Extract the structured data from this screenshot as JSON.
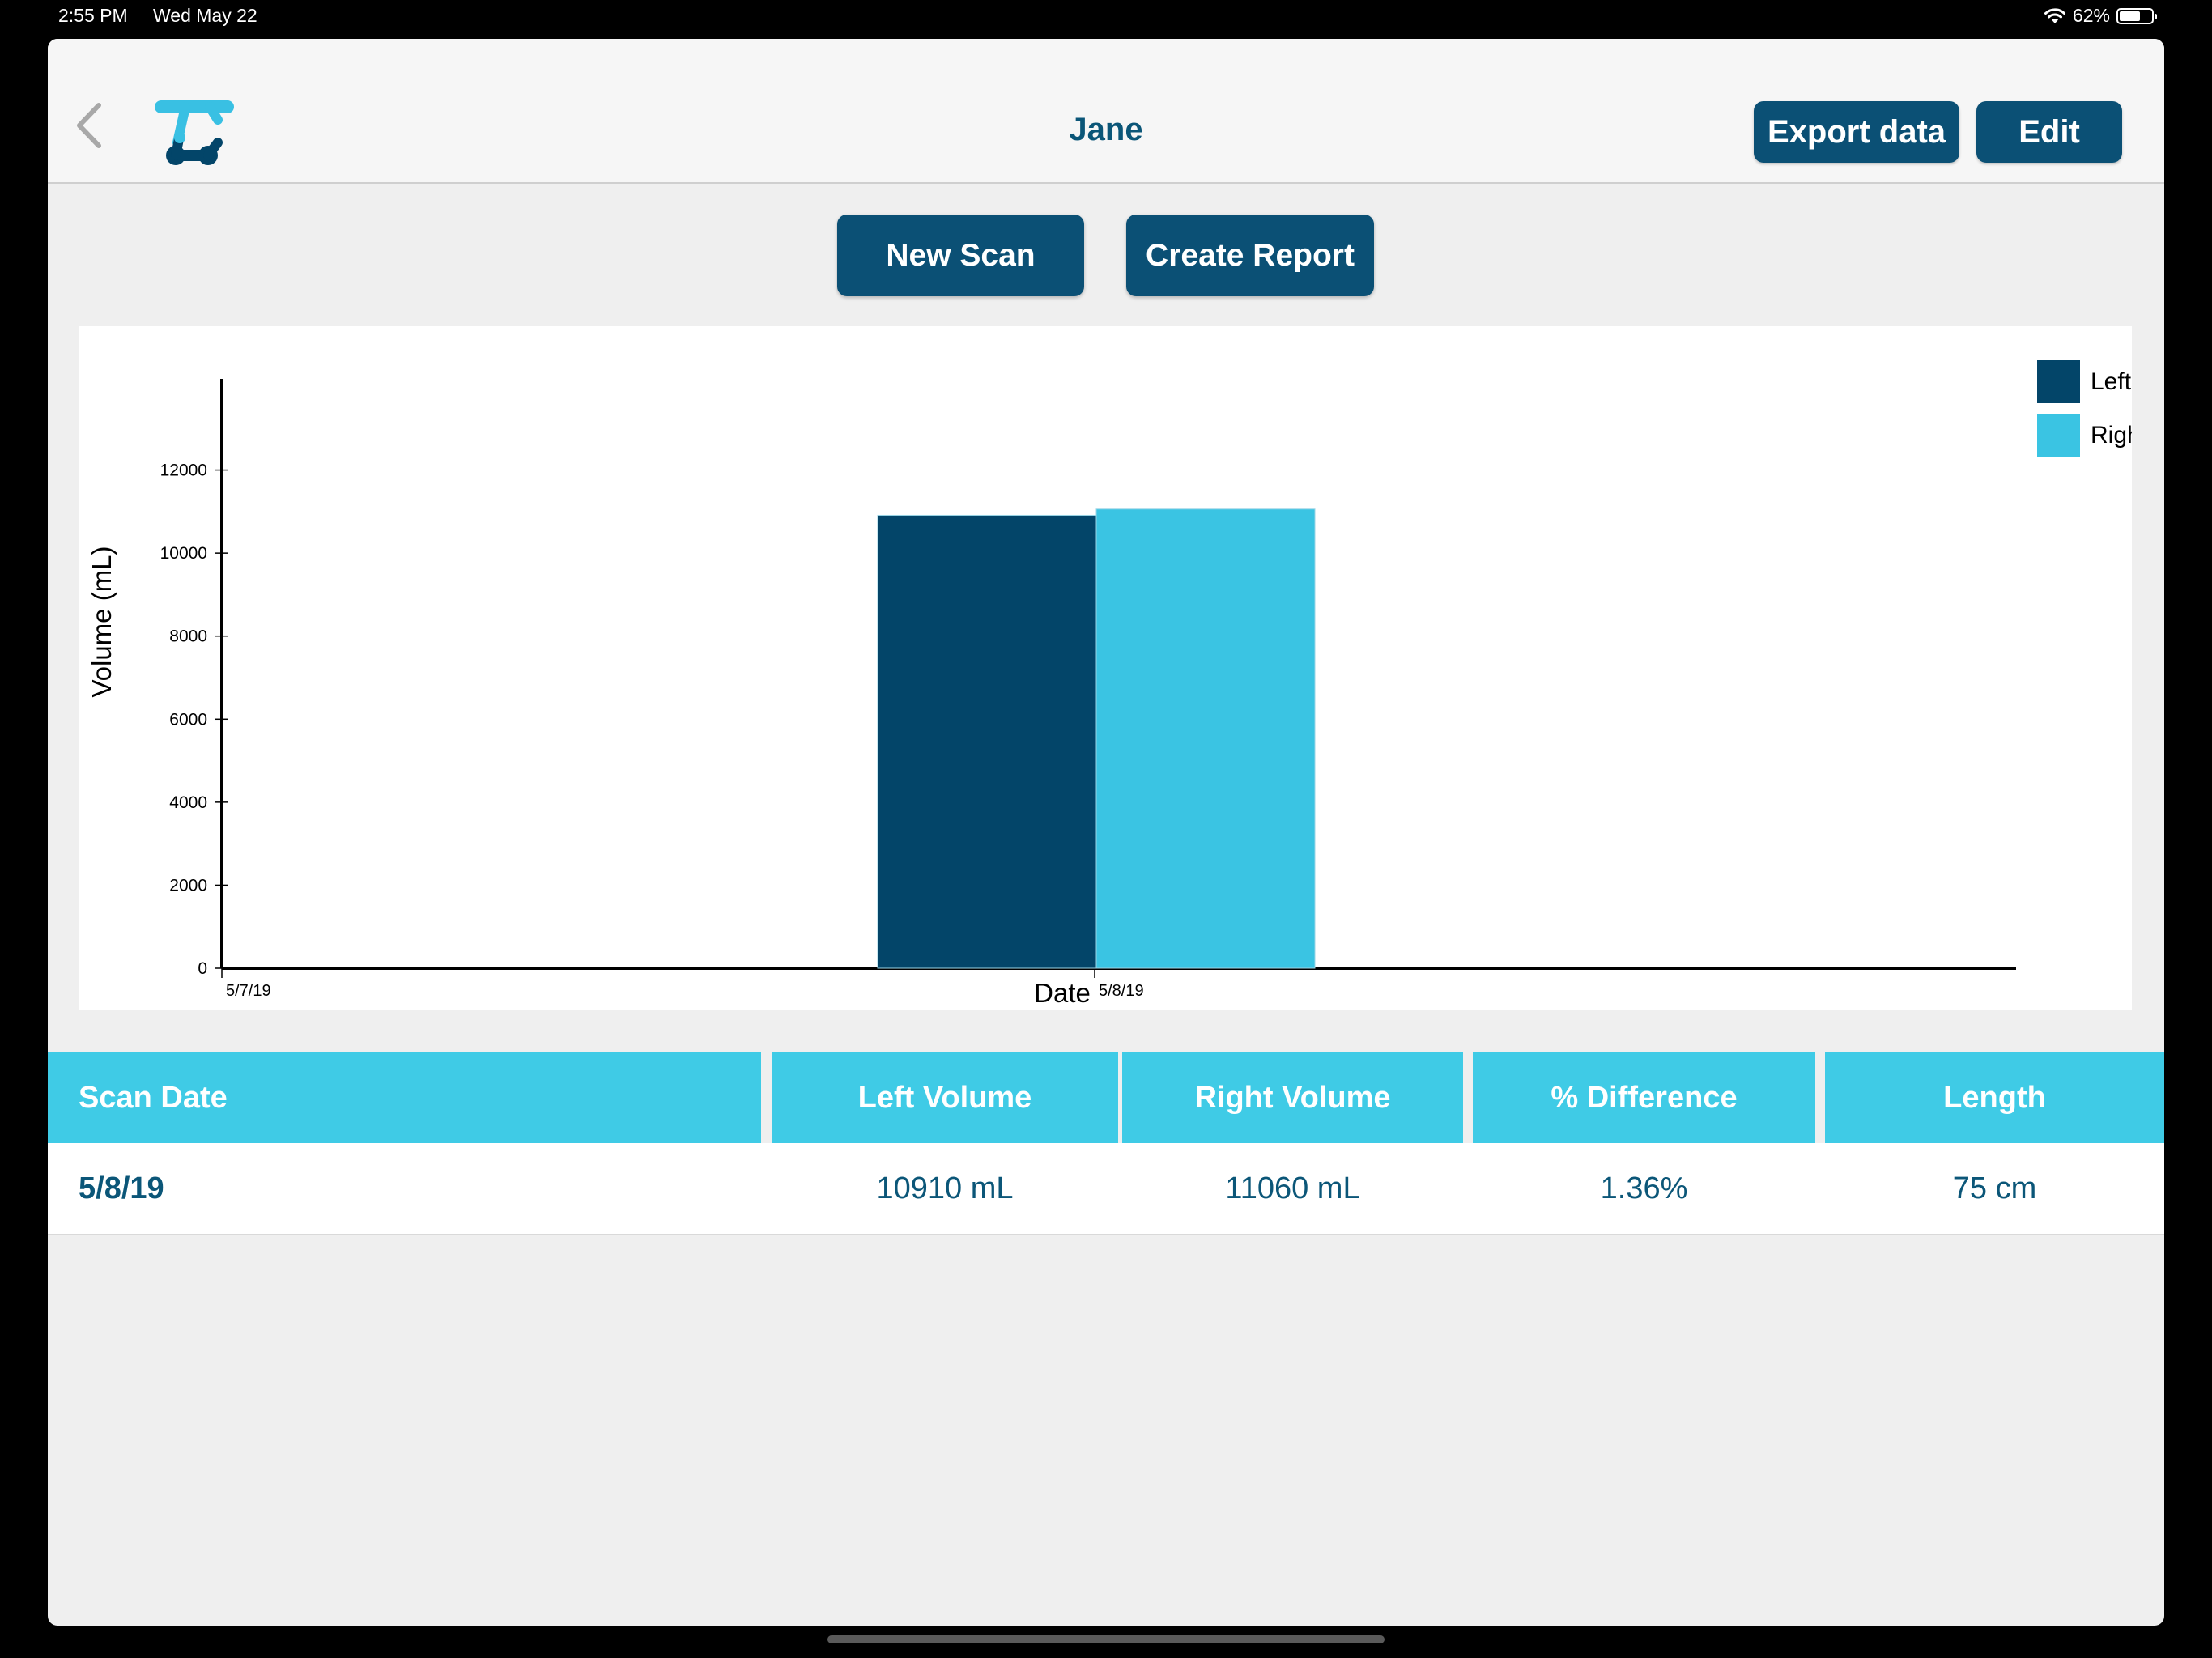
{
  "status_bar": {
    "time": "2:55 PM",
    "date": "Wed May 22",
    "battery": "62%"
  },
  "nav": {
    "title": "Jane",
    "export_label": "Export data",
    "edit_label": "Edit"
  },
  "actions": {
    "new_scan_label": "New Scan",
    "create_report_label": "Create Report"
  },
  "colors": {
    "left": "#034569",
    "right": "#3ac4e3",
    "header": "#3fcbe6",
    "button": "#0b5075"
  },
  "chart_data": {
    "type": "bar",
    "xlabel": "Date",
    "ylabel": "Volume (mL)",
    "x_ticks": [
      "5/7/19",
      "5/8/19"
    ],
    "categories": [
      "5/8/19"
    ],
    "series": [
      {
        "name": "Left",
        "values": [
          10910
        ],
        "color": "#034569"
      },
      {
        "name": "Right",
        "values": [
          11060
        ],
        "color": "#3ac4e3"
      }
    ],
    "y_ticks": [
      0,
      2000,
      4000,
      6000,
      8000,
      10000,
      12000
    ],
    "ylim": [
      0,
      14000
    ],
    "legend_position": "top-right",
    "grid": false
  },
  "table": {
    "headers": [
      "Scan Date",
      "Left Volume",
      "Right Volume",
      "% Difference",
      "Length"
    ],
    "rows": [
      [
        "5/8/19",
        "10910 mL",
        "11060 mL",
        "1.36%",
        "75 cm"
      ]
    ]
  }
}
